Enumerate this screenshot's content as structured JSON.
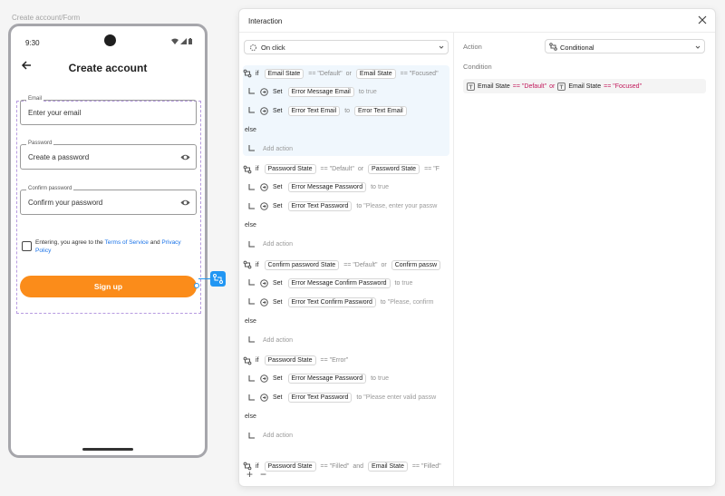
{
  "frame_label": "Create account/Form",
  "phone": {
    "time": "9:30",
    "title": "Create account",
    "fields": [
      {
        "label": "Email",
        "value": "Enter your email"
      },
      {
        "label": "Password",
        "value": "Create a password"
      },
      {
        "label": "Confirm password",
        "value": "Confirm your password"
      }
    ],
    "terms_prefix": "Entering, you agree to the ",
    "terms_link": "Terms of Service",
    "terms_and": " and ",
    "privacy_link": "Privacy Policy",
    "signup_label": "Sign up"
  },
  "dialog": {
    "title": "Interaction",
    "trigger": "On click",
    "blocks": [
      {
        "if": {
          "a": "Email State",
          "op1": "== \"Default\"",
          "or": "or",
          "b": "Email State",
          "op2": "== \"Focused\""
        },
        "set1": {
          "kw": "Set",
          "target": "Error Message Email",
          "to": "to",
          "val": "true"
        },
        "set2": {
          "kw": "Set",
          "target": "Error Text Email",
          "to": "to",
          "val": "Error Text Email"
        },
        "else": "else",
        "add": "Add action"
      },
      {
        "if": {
          "a": "Password State",
          "op1": "== \"Default\"",
          "or": "or",
          "b": "Password State",
          "op2": "== \"F"
        },
        "set1": {
          "kw": "Set",
          "target": "Error Message Password",
          "to": "to",
          "val": "true"
        },
        "set2": {
          "kw": "Set",
          "target": "Error Text Password",
          "to": "to",
          "val": "\"Please, enter your passw"
        },
        "else": "else",
        "add": "Add action"
      },
      {
        "if": {
          "a": "Confirm password State",
          "op1": "== \"Default\"",
          "or": "or",
          "b": "Confirm passw",
          "op2": ""
        },
        "set1": {
          "kw": "Set",
          "target": "Error Message Confirm Password",
          "to": "to",
          "val": "true"
        },
        "set2": {
          "kw": "Set",
          "target": "Error Text Confirm Password",
          "to": "to",
          "val": "\"Please, confirm"
        },
        "else": "else",
        "add": "Add action"
      },
      {
        "if": {
          "a": "Password State",
          "op1": "== \"Error\"",
          "or": "",
          "b": "",
          "op2": ""
        },
        "set1": {
          "kw": "Set",
          "target": "Error Message Password",
          "to": "to",
          "val": "true"
        },
        "set2": {
          "kw": "Set",
          "target": "Error Text Password",
          "to": "to",
          "val": "\"Please enter valid passw"
        },
        "else": "else",
        "add": "Add action"
      }
    ],
    "last_if": {
      "a": "Password State",
      "op1": "== \"Filled\"",
      "and": "and",
      "b": "Email State",
      "op2": "== \"Filled\""
    },
    "if_kw": "if",
    "footer_add": "+",
    "footer_remove": "−",
    "action_label": "Action",
    "action_value": "Conditional",
    "condition_label": "Condition",
    "condition": {
      "a": "Email State",
      "op1": "== \"Default\"",
      "or": "or",
      "b": "Email State",
      "op2": "== \"Focused\""
    },
    "colors": {
      "accent": "#2196f3",
      "signup": "#fb8c1a",
      "highlight": "#f0f7fd",
      "op_pink": "#c2185b"
    }
  }
}
